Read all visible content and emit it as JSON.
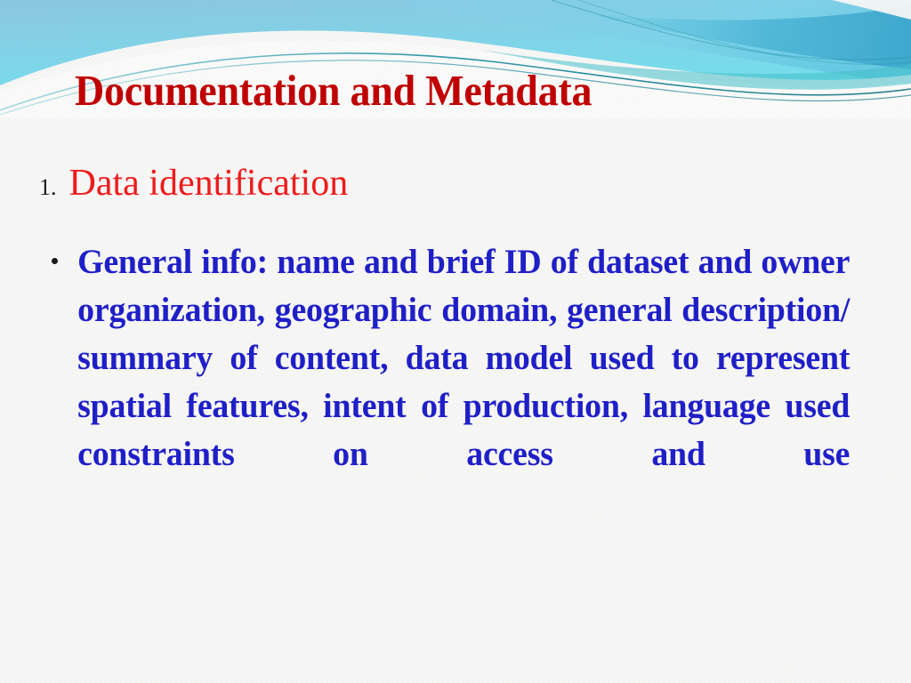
{
  "slide": {
    "title": "Documentation and Metadata",
    "background_color": "#f7f7f6",
    "title_color": "#c00000"
  },
  "header_art": {
    "name": "wave-banner",
    "gradient_top_color": "#85c7e2",
    "gradient_bottom_color": "#72e2ec",
    "band_color": "#4fb8d8",
    "accent_line_color": "#1f8fa0",
    "swoosh_color": "#ffffff"
  },
  "heading": {
    "number": "1.",
    "text": "Data identification",
    "number_color": "#1a1a1a",
    "text_color": "#ee1c1c"
  },
  "body": {
    "bullet_glyph": "bullet-dot",
    "text_color": "#1f1fc8",
    "items": [
      "General info: name and brief ID of dataset and owner organization, geographic domain, general description/ summary of content, data model used to represent spatial features, intent of production, language used constraints on access and use"
    ]
  }
}
